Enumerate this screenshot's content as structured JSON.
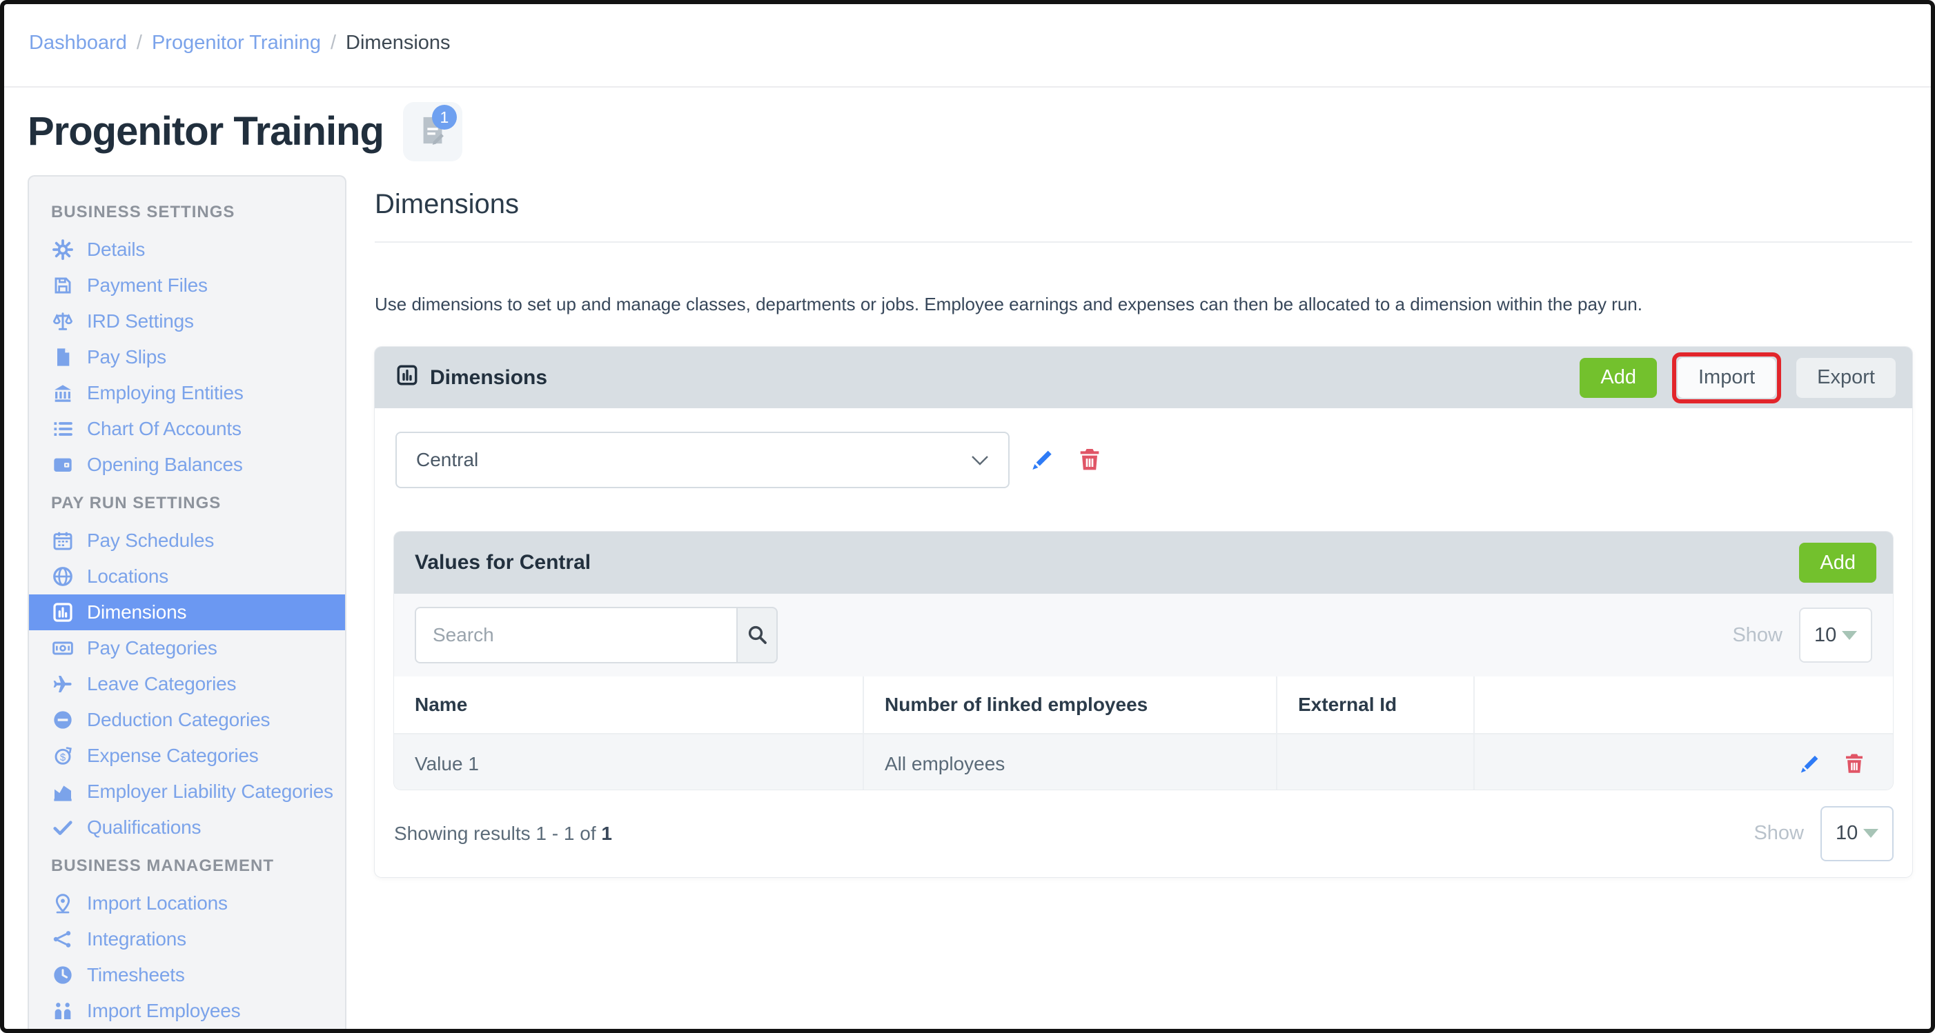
{
  "breadcrumb": {
    "separator": "/",
    "items": [
      {
        "label": "Dashboard"
      },
      {
        "label": "Progenitor Training"
      },
      {
        "label": "Dimensions"
      }
    ]
  },
  "page": {
    "title": "Progenitor Training",
    "notes_badge": "1"
  },
  "sidebar": {
    "sections": [
      {
        "label": "BUSINESS SETTINGS",
        "items": [
          {
            "label": "Details",
            "icon": "gear-icon"
          },
          {
            "label": "Payment Files",
            "icon": "floppy-disk-icon"
          },
          {
            "label": "IRD Settings",
            "icon": "scales-icon"
          },
          {
            "label": "Pay Slips",
            "icon": "file-icon"
          },
          {
            "label": "Employing Entities",
            "icon": "bank-icon"
          },
          {
            "label": "Chart Of Accounts",
            "icon": "list-icon"
          },
          {
            "label": "Opening Balances",
            "icon": "wallet-icon"
          }
        ]
      },
      {
        "label": "PAY RUN SETTINGS",
        "items": [
          {
            "label": "Pay Schedules",
            "icon": "calendar-icon"
          },
          {
            "label": "Locations",
            "icon": "globe-icon"
          },
          {
            "label": "Dimensions",
            "icon": "bar-chart-icon",
            "selected": true
          },
          {
            "label": "Pay Categories",
            "icon": "banknote-icon"
          },
          {
            "label": "Leave Categories",
            "icon": "plane-icon"
          },
          {
            "label": "Deduction Categories",
            "icon": "minus-circle-icon"
          },
          {
            "label": "Expense Categories",
            "icon": "dollar-cycle-icon"
          },
          {
            "label": "Employer Liability Categories",
            "icon": "area-chart-icon"
          },
          {
            "label": "Qualifications",
            "icon": "check-icon"
          }
        ]
      },
      {
        "label": "BUSINESS MANAGEMENT",
        "items": [
          {
            "label": "Import Locations",
            "icon": "map-pin-icon"
          },
          {
            "label": "Integrations",
            "icon": "branch-icon"
          },
          {
            "label": "Timesheets",
            "icon": "clock-icon"
          },
          {
            "label": "Import Employees",
            "icon": "people-icon"
          }
        ]
      }
    ]
  },
  "main": {
    "heading": "Dimensions",
    "description": "Use dimensions to set up and manage classes, departments or jobs. Employee earnings and expenses can then be allocated to a dimension within the pay run.",
    "panel": {
      "title": "Dimensions",
      "buttons": {
        "add": "Add",
        "import": "Import",
        "export": "Export"
      },
      "dimension_select": {
        "value": "Central"
      },
      "values_panel": {
        "title": "Values for Central",
        "add_label": "Add",
        "search": {
          "placeholder": "Search"
        },
        "show_label": "Show",
        "page_size": "10",
        "table": {
          "columns": [
            "Name",
            "Number of linked employees",
            "External Id"
          ],
          "rows": [
            {
              "name": "Value 1",
              "linked_employees": "All employees",
              "external_id": ""
            }
          ]
        },
        "footer": {
          "summary_prefix": "Showing results 1 - 1 of ",
          "summary_total": "1",
          "show_label": "Show",
          "page_size": "10"
        }
      }
    }
  },
  "colors": {
    "link_blue": "#7ba3ea",
    "selected_blue": "#6b98f2",
    "header_gray": "#d8dee3",
    "add_green": "#73c12d",
    "annotation_red": "#e2252b",
    "edit_blue": "#2e7bf6",
    "delete_red": "#e05566",
    "navy_text": "#22303e"
  }
}
